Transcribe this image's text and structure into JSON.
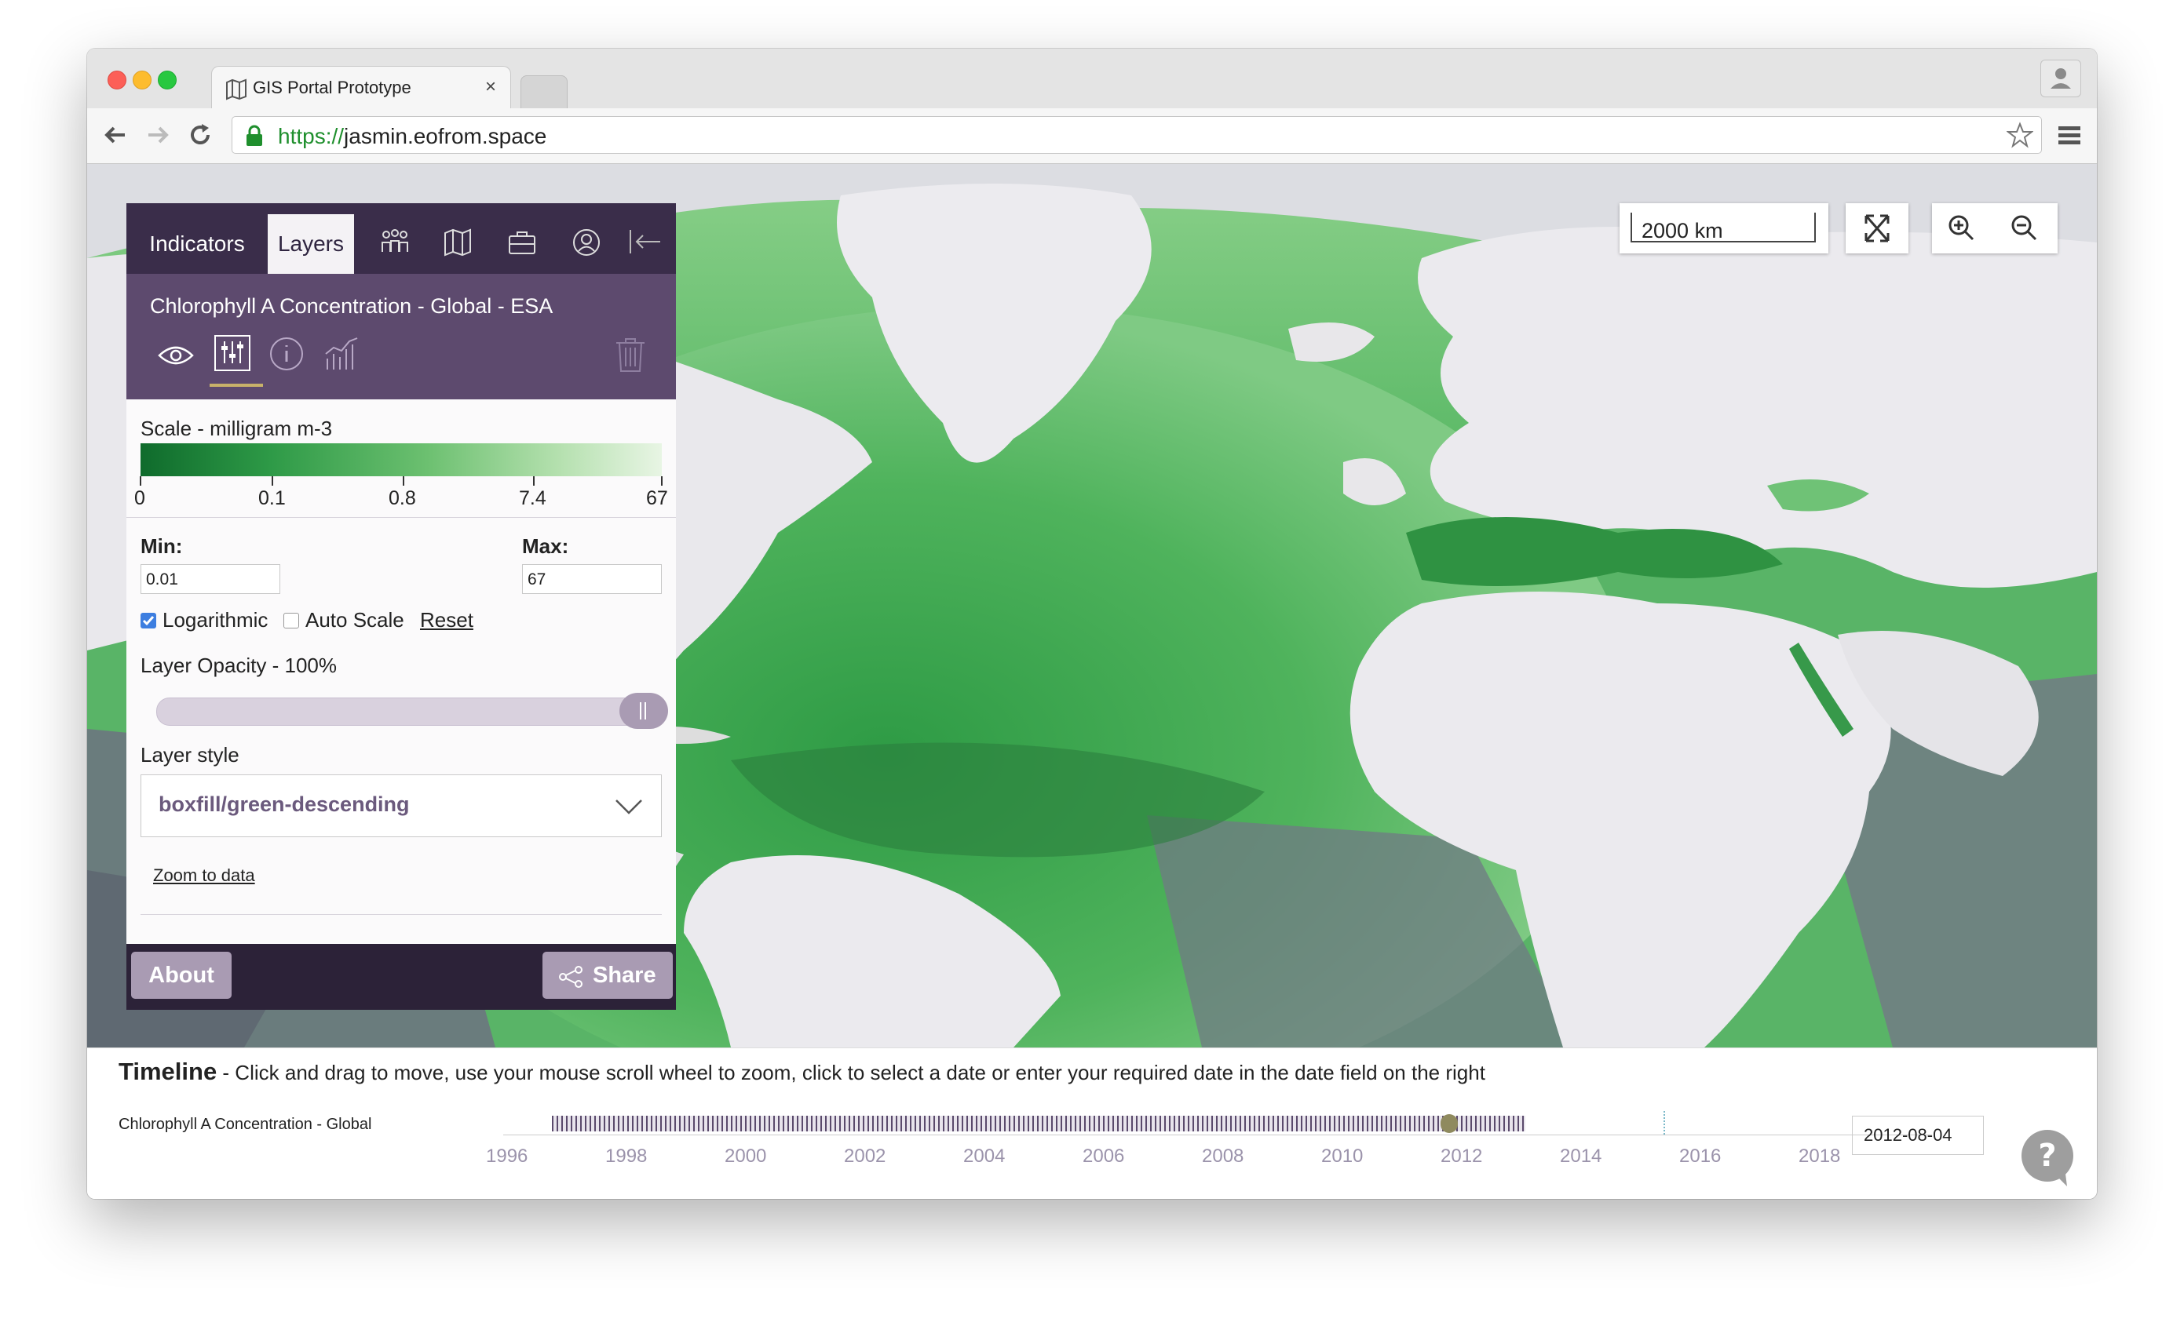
{
  "browser": {
    "tab_title": "GIS Portal Prototype",
    "tab_close": "×",
    "url_scheme": "https://",
    "url_host": "jasmin.eofrom.space"
  },
  "panel": {
    "tabs": [
      {
        "label": "Indicators"
      },
      {
        "label": "Layers"
      }
    ],
    "tab_icons": [
      "people-icon",
      "map-icon",
      "briefcase-icon",
      "user-circle-icon",
      "collapse-arrow-icon"
    ],
    "layer_title": "Chlorophyll A Concentration - Global - ESA",
    "layer_tools": [
      "eye-icon",
      "sliders-icon",
      "info-icon",
      "chart-icon",
      "trash-icon"
    ],
    "scale_label": "Scale - milligram m-3",
    "scale_ticks": [
      "0",
      "0.1",
      "0.8",
      "7.4",
      "67"
    ],
    "min_label": "Min:",
    "min_value": "0.01",
    "max_label": "Max:",
    "max_value": "67",
    "logarithmic_label": "Logarithmic",
    "logarithmic_checked": true,
    "autoscale_label": "Auto Scale",
    "autoscale_checked": false,
    "reset_label": "Reset",
    "opacity_label": "Layer Opacity - 100%",
    "opacity_value": 1.0,
    "style_label": "Layer style",
    "style_value": "boxfill/green-descending",
    "zoom_link": "Zoom to data",
    "about_label": "About",
    "share_label": "Share"
  },
  "map": {
    "scale_text": "2000 km",
    "controls": [
      "fullscreen-icon",
      "zoom-in-icon",
      "zoom-out-icon"
    ]
  },
  "timeline": {
    "title": "Timeline",
    "instructions": " - Click and drag to move, use your mouse scroll wheel to zoom, click to select a date or enter your required date in the date field on the right",
    "layer_label": "Chlorophyll A Concentration - Global",
    "years": [
      "1996",
      "1998",
      "2000",
      "2002",
      "2004",
      "2006",
      "2008",
      "2010",
      "2012",
      "2014",
      "2016",
      "2018"
    ],
    "date_value": "2012-08-04"
  },
  "colors": {
    "panel_dark": "#3a2d4a",
    "panel_header": "#5d4a6e",
    "button": "#a99bb3",
    "ocean_green": "#3aa14b",
    "land": "#e8e7ea"
  }
}
